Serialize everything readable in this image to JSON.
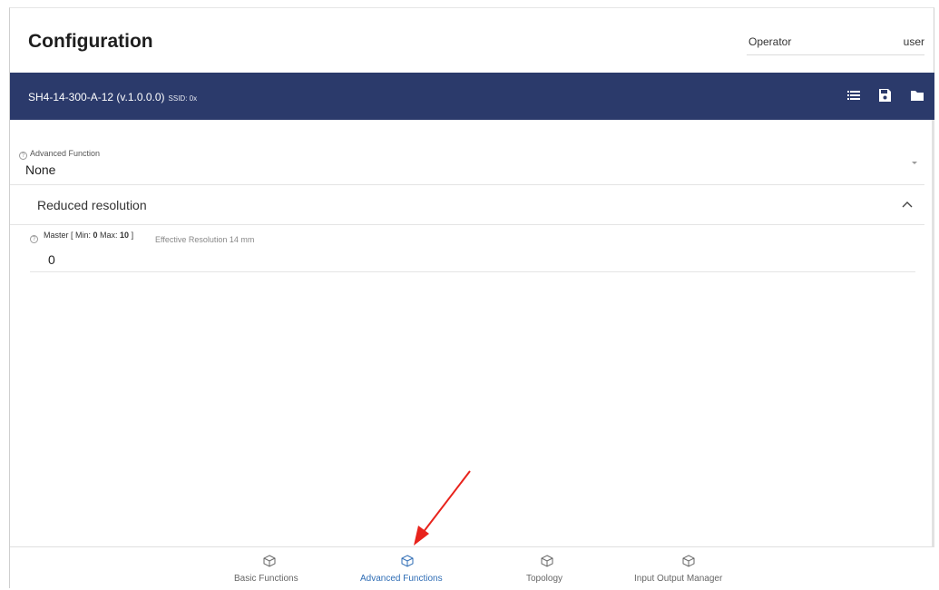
{
  "header": {
    "title": "Configuration",
    "role": "Operator",
    "user": "user"
  },
  "device_bar": {
    "device_name": "SH4-14-300-A-12 (v.1.0.0.0)",
    "ssid_label": "SSID: 0x",
    "icons": [
      "list-icon",
      "save-icon",
      "folder-icon"
    ],
    "background_color": "#2b3a6b"
  },
  "advanced_function": {
    "label": "Advanced Function",
    "value": "None"
  },
  "reduced_resolution": {
    "title": "Reduced resolution",
    "expanded": true
  },
  "master": {
    "label_prefix": "Master [ Min: ",
    "min": "0",
    "label_mid": " Max: ",
    "max": "10",
    "label_suffix": " ]",
    "effective": "Effective Resolution 14 mm",
    "value": "0"
  },
  "nav": {
    "active_color": "#2f6db5",
    "items": [
      {
        "label": "Basic Functions",
        "icon": "cube-icon",
        "active": false
      },
      {
        "label": "Advanced Functions",
        "icon": "cube-icon",
        "active": true
      },
      {
        "label": "Topology",
        "icon": "cube-icon",
        "active": false
      },
      {
        "label": "Input Output Manager",
        "icon": "cube-icon",
        "active": false
      }
    ]
  },
  "annotation": {
    "arrow_color": "#e8231c",
    "points_to": "Advanced Functions"
  }
}
